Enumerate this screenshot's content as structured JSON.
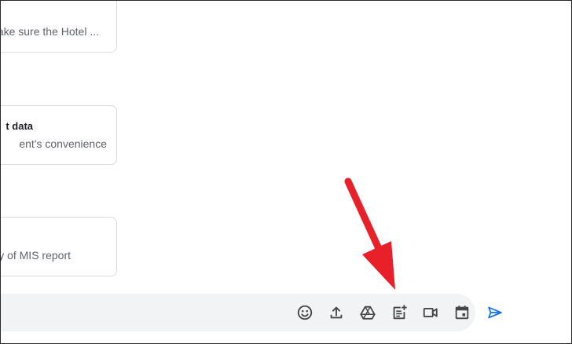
{
  "messages": [
    {
      "title": "",
      "snippet": "ake sure the Hotel ..."
    },
    {
      "title": "t data",
      "snippet": "ent's convenience"
    },
    {
      "title": "",
      "snippet": "y of MIS report"
    }
  ],
  "composer": {
    "toolbar": [
      {
        "icon": "emoji-icon"
      },
      {
        "icon": "upload-icon"
      },
      {
        "icon": "google-drive-icon"
      },
      {
        "icon": "create-document-icon"
      },
      {
        "icon": "video-meeting-icon"
      },
      {
        "icon": "calendar-invite-icon"
      }
    ],
    "send_icon": "send-icon"
  },
  "annotation": {
    "arrow_color": "#e8202a",
    "points_to": "create-document-icon"
  },
  "colors": {
    "icon": "#444746",
    "send": "#1a73e8",
    "composer_bg": "#f1f3f4",
    "card_border": "#dadce0"
  }
}
